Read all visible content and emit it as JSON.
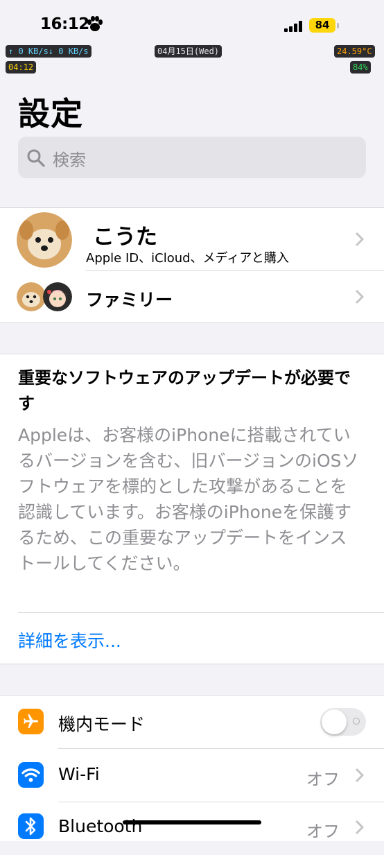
{
  "status_bar": {
    "time": "16:12",
    "battery_level": "84",
    "net_speed": "↑ 0 KB/s↓ 0 KB/s",
    "date": "04月15日(Wed)",
    "temperature": "24.59°C",
    "uptime": "04:12",
    "battery_percent": "84%"
  },
  "page": {
    "title": "設定"
  },
  "search": {
    "placeholder": "検索"
  },
  "profile": {
    "name": "こうた",
    "subtitle": "Apple ID、iCloud、メディアと購入",
    "family_label": "ファミリー"
  },
  "update_notice": {
    "title": "重要なソフトウェアのアップデートが必要です",
    "body": "Appleは、お客様のiPhoneに搭載されているバージョンを含む、旧バージョンのiOSソフトウェアを標的とした攻撃があることを認識しています。お客様のiPhoneを保護するため、この重要なアップデートをインストールしてください。",
    "link": "詳細を表示..."
  },
  "settings": [
    {
      "label": "機内モード",
      "icon": "airplane-icon",
      "color": "#ff9500",
      "toggle": false
    },
    {
      "label": "Wi-Fi",
      "icon": "wifi-icon",
      "color": "#007aff",
      "value": "オフ"
    },
    {
      "label": "Bluetooth",
      "icon": "bluetooth-icon",
      "color": "#007aff",
      "value": "オフ"
    }
  ],
  "colors": {
    "accent": "#007aff",
    "background": "#f2f2f7",
    "battery_badge": "#ffd60a"
  }
}
